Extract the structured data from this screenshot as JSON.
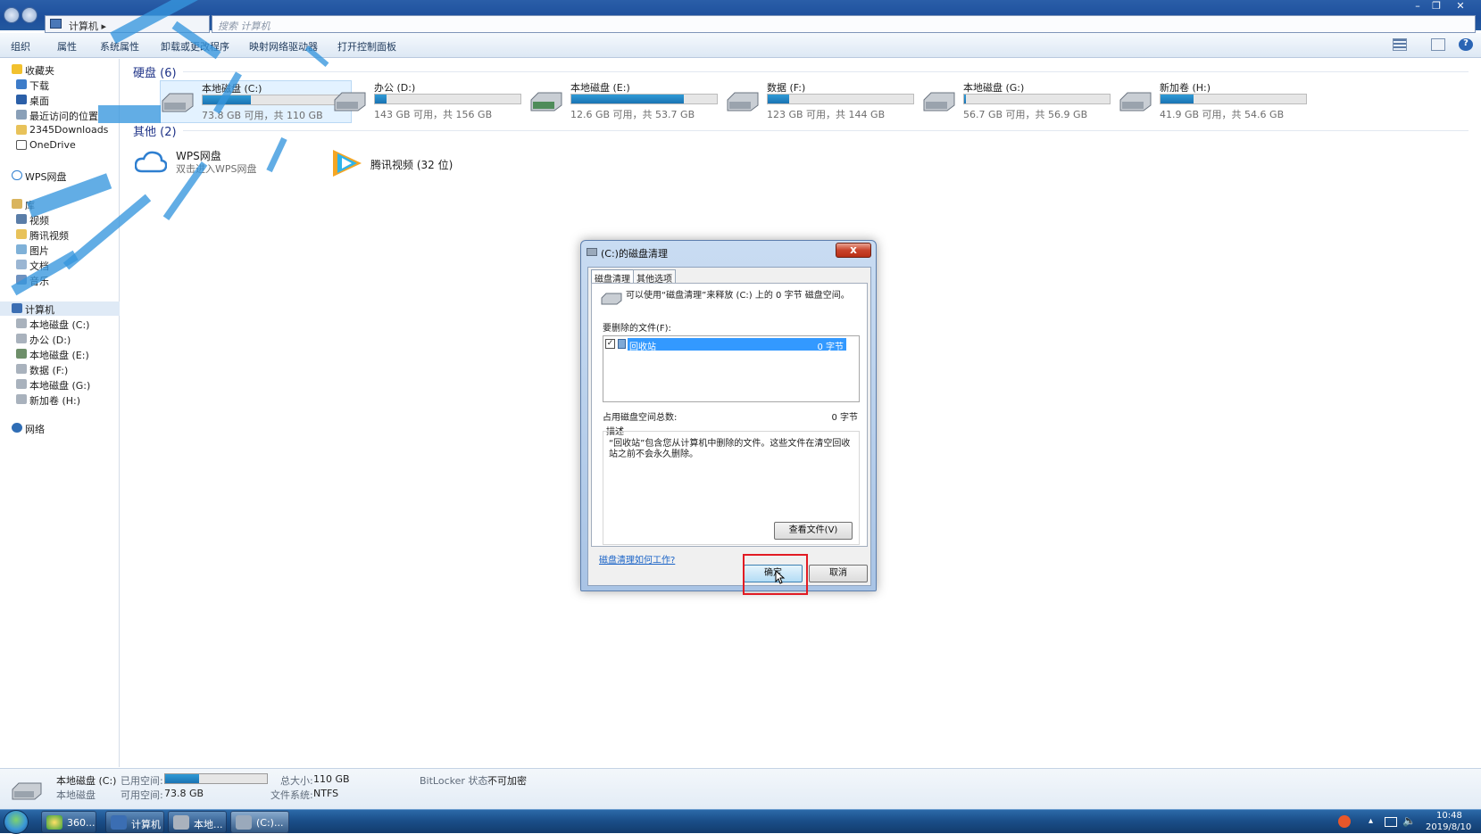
{
  "window": {
    "address_path": "计算机 ▸",
    "search_placeholder": "搜索 计算机",
    "controls": [
      "–",
      "❐",
      "✕"
    ]
  },
  "toolbar": {
    "items": [
      "组织",
      "属性",
      "系统属性",
      "卸载或更改程序",
      "映射网络驱动器",
      "打开控制面板"
    ]
  },
  "sidebar": {
    "favorites": [
      "收藏夹",
      "下载",
      "桌面",
      "最近访问的位置",
      "2345Downloads",
      "OneDrive"
    ],
    "wps": "WPS网盘",
    "libraries": [
      "库",
      "视频",
      "腾讯视频",
      "图片",
      "文档",
      "音乐"
    ],
    "computer": [
      "计算机",
      "本地磁盘 (C:)",
      "办公 (D:)",
      "本地磁盘 (E:)",
      "数据 (F:)",
      "本地磁盘 (G:)",
      "新加卷 (H:)"
    ],
    "network": "网络"
  },
  "content": {
    "hdd_group_title": "硬盘 (6)",
    "drives": [
      {
        "name": "本地磁盘 (C:)",
        "free_text": "73.8 GB 可用，共 110 GB",
        "used_fraction": 0.33
      },
      {
        "name": "办公 (D:)",
        "free_text": "143 GB 可用，共 156 GB",
        "used_fraction": 0.08
      },
      {
        "name": "本地磁盘 (E:)",
        "free_text": "12.6 GB 可用，共 53.7 GB",
        "used_fraction": 0.77
      },
      {
        "name": "数据 (F:)",
        "free_text": "123 GB 可用，共 144 GB",
        "used_fraction": 0.15
      },
      {
        "name": "本地磁盘 (G:)",
        "free_text": "56.7 GB 可用，共 56.9 GB",
        "used_fraction": 0.004
      },
      {
        "name": "新加卷 (H:)",
        "free_text": "41.9 GB 可用，共 54.6 GB",
        "used_fraction": 0.23
      }
    ],
    "other_group_title": "其他 (2)",
    "others": [
      {
        "name": "WPS网盘",
        "sub": "双击进入WPS网盘"
      },
      {
        "name": "腾讯视频 (32 位)",
        "sub": ""
      }
    ]
  },
  "dialog": {
    "title": "(C:)的磁盘清理",
    "close": "x",
    "tabs": [
      "磁盘清理",
      "其他选项"
    ],
    "intro": "可以使用“磁盘清理”来释放 (C:) 上的 0 字节 磁盘空间。",
    "files_label": "要删除的文件(F):",
    "file_item": {
      "checked": true,
      "name": "回收站",
      "size": "0 字节"
    },
    "total_label": "占用磁盘空间总数:",
    "total_value": "0 字节",
    "desc_label": "描述",
    "desc_text": "“回收站”包含您从计算机中删除的文件。这些文件在清空回收站之前不会永久删除。",
    "view_files": "查看文件(V)",
    "help_link": "磁盘清理如何工作?",
    "ok": "确定",
    "cancel": "取消"
  },
  "details": {
    "drive_name": "本地磁盘 (C:)",
    "drive_type": "本地磁盘",
    "used_label": "已用空间:",
    "used_fraction": 0.33,
    "free_label": "可用空间:",
    "free_value": "73.8 GB",
    "total_label": "总大小:",
    "total_value": "110 GB",
    "fs_label": "文件系统:",
    "fs_value": "NTFS",
    "bitlocker_label": "BitLocker 状态:",
    "bitlocker_value": "不可加密"
  },
  "taskbar": {
    "tasks": [
      "360...",
      "计算机",
      "本地...",
      "(C:)..."
    ],
    "time": "10:48",
    "date": "2019/8/10"
  }
}
